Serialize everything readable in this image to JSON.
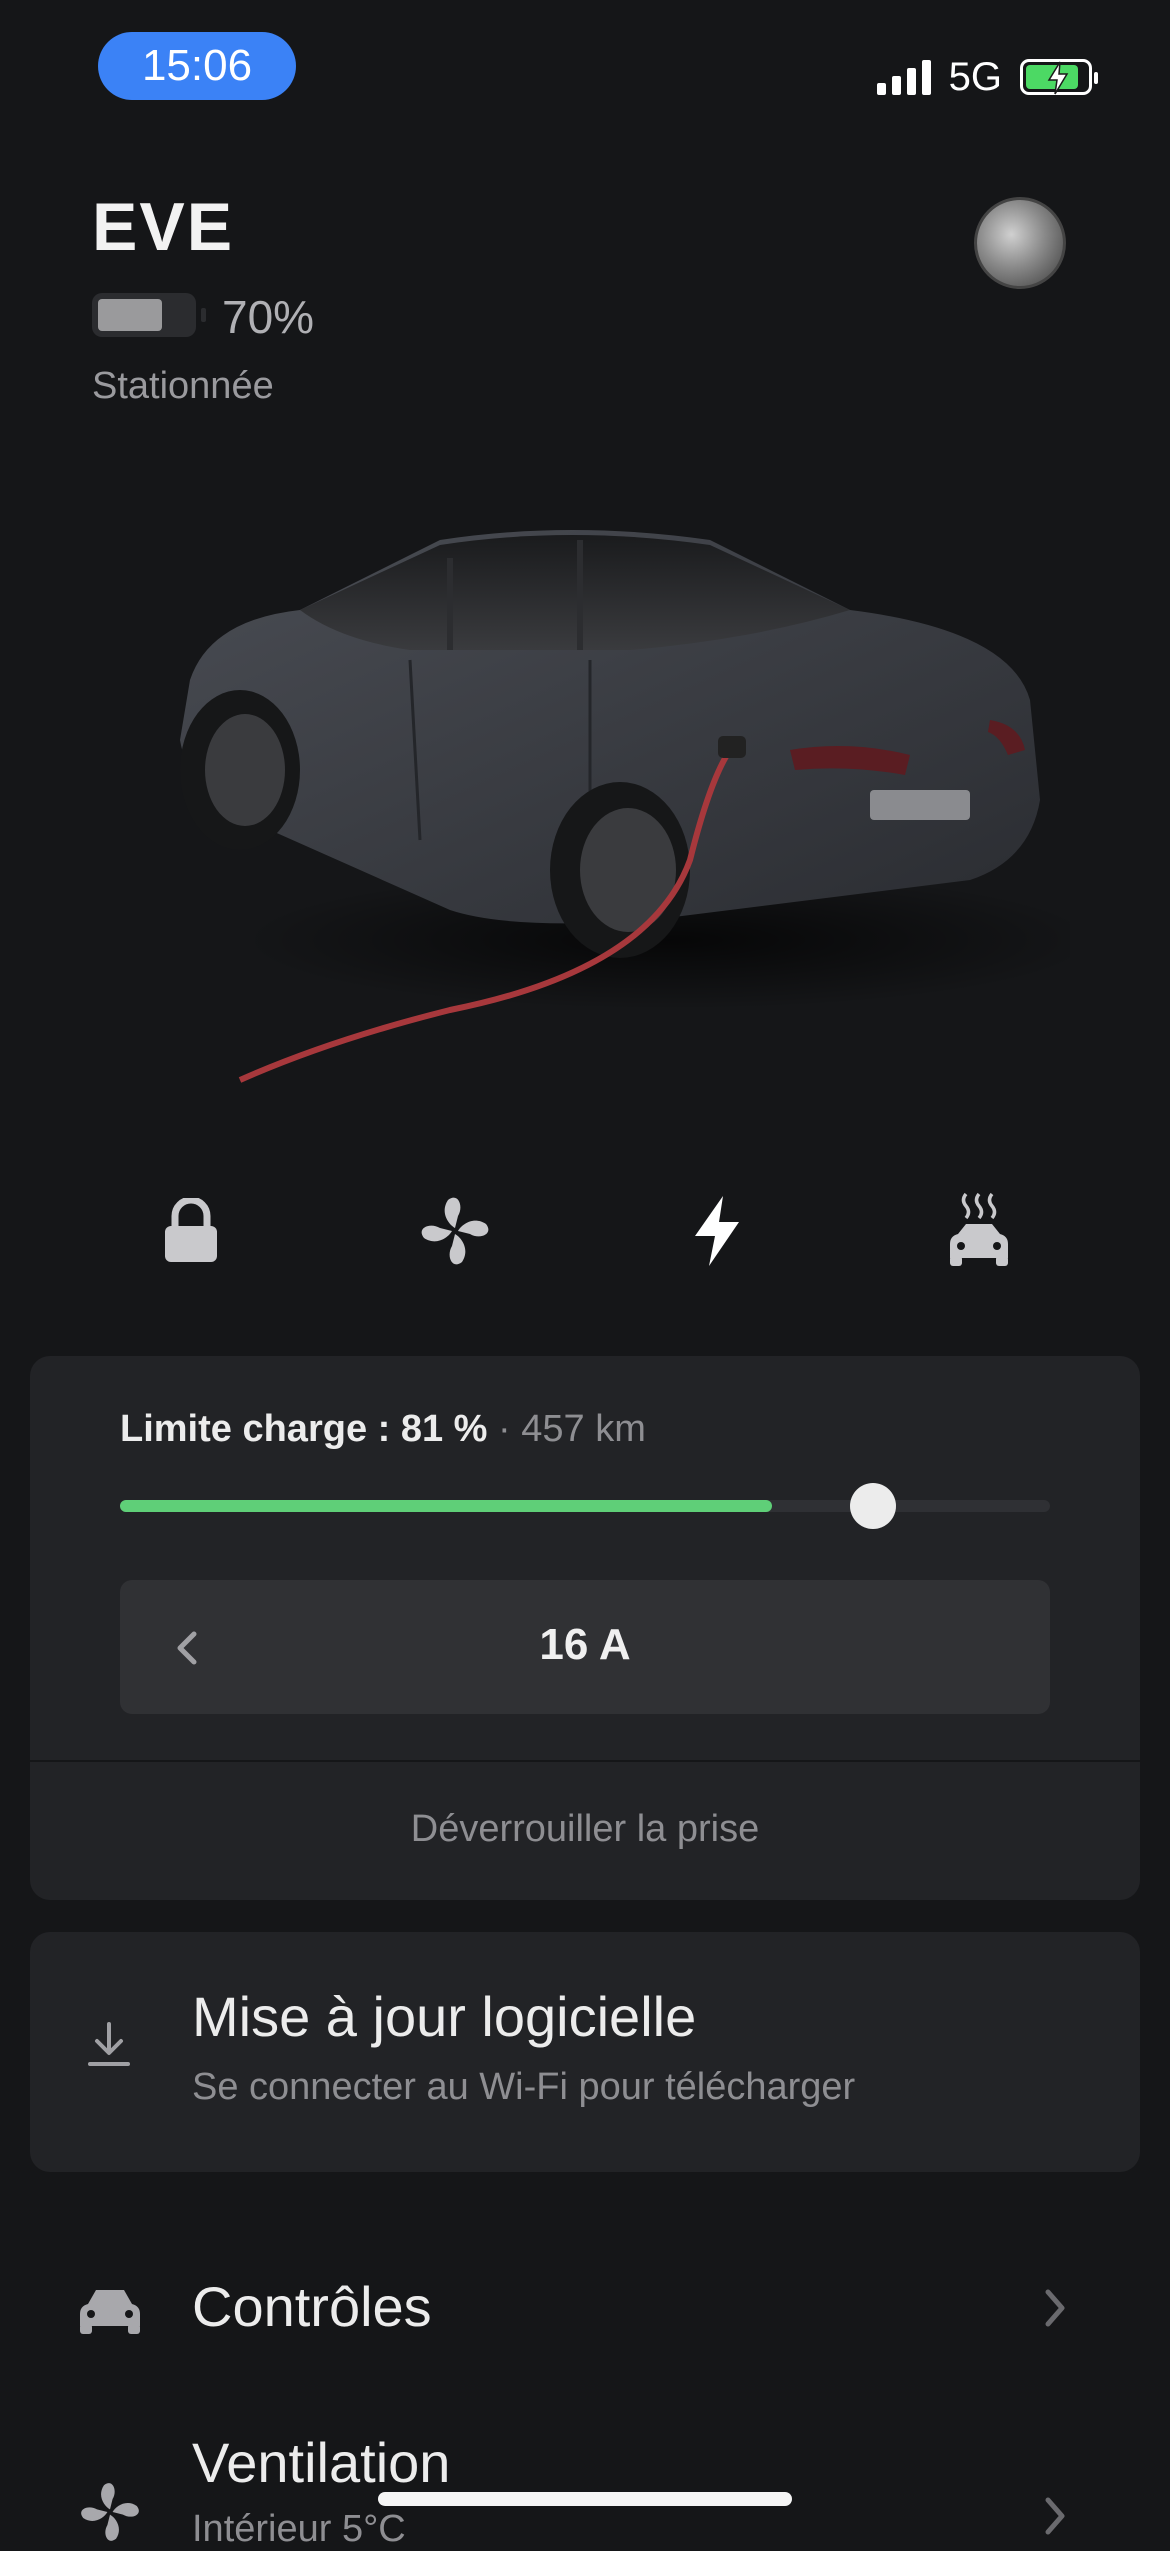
{
  "status_bar": {
    "time": "15:06",
    "network": "5G",
    "colors": {
      "time_pill": "#3b82f6",
      "battery": "#4cd964"
    }
  },
  "vehicle": {
    "name": "EVE",
    "battery_percent": "70%",
    "battery_level": 0.7,
    "state": "Stationnée"
  },
  "actions": [
    {
      "icon": "lock-icon"
    },
    {
      "icon": "fan-icon"
    },
    {
      "icon": "charge-bolt-icon",
      "active": true
    },
    {
      "icon": "climate-car-icon"
    }
  ],
  "charge": {
    "limit_label": "Limite charge : 81 %",
    "range": "· 457 km",
    "current_level": 0.7,
    "limit_level": 0.81,
    "amperage": "16 A",
    "unlock_label": "Déverrouiller la prise",
    "colors": {
      "fill": "#5fcf78"
    }
  },
  "software_update": {
    "title": "Mise à jour logicielle",
    "subtitle": "Se connecter au Wi-Fi pour télécharger",
    "icon": "download-icon"
  },
  "menu": [
    {
      "label": "Contrôles",
      "icon": "car-icon"
    },
    {
      "label": "Ventilation",
      "sublabel": "Intérieur 5°C",
      "icon": "fan-icon"
    }
  ]
}
